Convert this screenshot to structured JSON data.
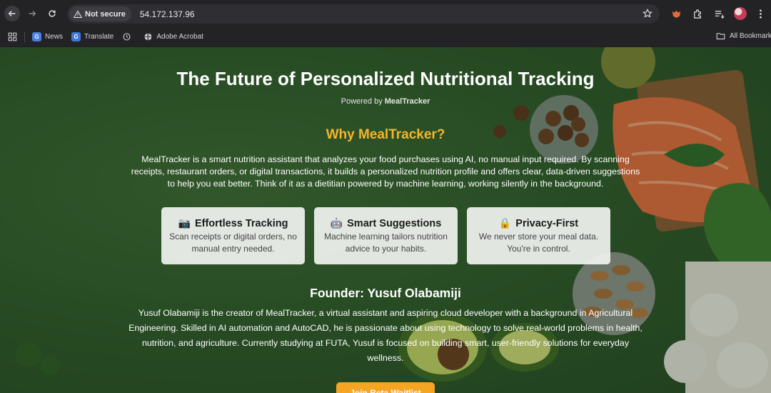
{
  "browser": {
    "security_label": "Not secure",
    "url": "54.172.137.96",
    "bookmarks": [
      {
        "label": "News",
        "icon": "news-icon"
      },
      {
        "label": "Translate",
        "icon": "translate-icon"
      },
      {
        "label": "",
        "icon": "history-icon"
      },
      {
        "label": "Adobe Acrobat",
        "icon": "globe-icon"
      }
    ],
    "all_bookmarks_label": "All Bookmarks"
  },
  "page": {
    "title": "The Future of Personalized Nutritional Tracking",
    "powered_prefix": "Powered by ",
    "powered_brand": "MealTracker",
    "why_prefix": "Why ",
    "why_brand": "MealTracker?",
    "intro": "MealTracker is a smart nutrition assistant that analyzes your food purchases using AI, no manual input required. By scanning receipts, restaurant orders, or digital transactions, it builds a personalized nutrition profile and offers clear, data-driven suggestions to help you eat better. Think of it as a dietitian powered by machine learning, working silently in the background.",
    "features": [
      {
        "icon": "📷",
        "title": "Effortless Tracking",
        "desc": "Scan receipts or digital orders, no manual entry needed."
      },
      {
        "icon": "🤖",
        "title": "Smart Suggestions",
        "desc": "Machine learning tailors nutrition advice to your habits."
      },
      {
        "icon": "🔒",
        "title": "Privacy-First",
        "desc": "We never store your meal data. You're in control."
      }
    ],
    "founder_heading": "Founder: Yusuf Olabamiji",
    "founder_bio": "Yusuf Olabamiji is the creator of MealTracker, a virtual assistant and aspiring cloud developer with a background in Agricultural Engineering. Skilled in AI automation and AutoCAD, he is passionate about using technology to solve real-world problems in health, nutrition, and agriculture. Currently studying at FUTA, Yusuf is focused on building smart, user-friendly solutions for everyday wellness.",
    "cta_label": "Join Beta Waitlist"
  },
  "colors": {
    "accent": "#f5b62a",
    "button": "#f5a524",
    "background": "#2f5a2b"
  }
}
